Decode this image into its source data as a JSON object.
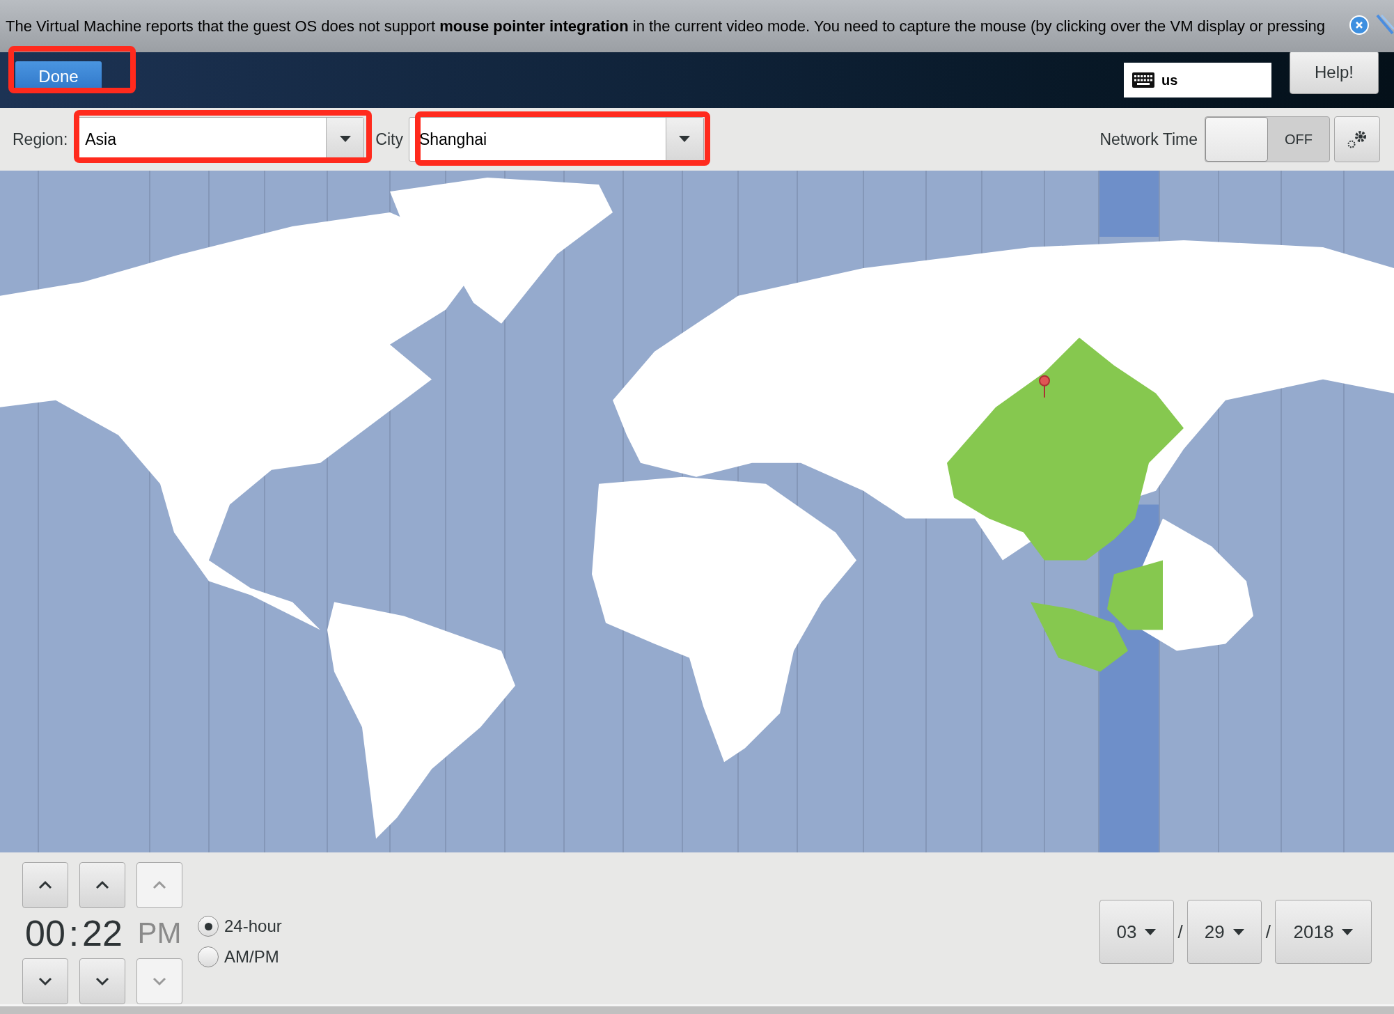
{
  "notification": {
    "text": "The Virtual Machine reports that the guest OS does not support **mouse pointer integration** in the current video mode. You need to capture the mouse (by clicking over the VM display or pressing"
  },
  "header": {
    "done_button": "Done",
    "keyboard_layout": "us",
    "help_button": "Help!"
  },
  "toolbar": {
    "region": {
      "label": "Region:",
      "value": "Asia"
    },
    "city": {
      "label": "City",
      "value": "Shanghai"
    },
    "network_time": {
      "label": "Network Time",
      "on": false,
      "state_text": "OFF"
    }
  },
  "time": {
    "hours": "00",
    "separator": ":",
    "minutes": "22",
    "ampm": "PM",
    "ampm_disabled": true
  },
  "format_options": [
    {
      "label": "24-hour",
      "selected": true
    },
    {
      "label": "AM/PM",
      "selected": false
    }
  ],
  "date": {
    "month": "03",
    "day": "29",
    "year": "2018",
    "separators": [
      "/",
      "/"
    ]
  }
}
